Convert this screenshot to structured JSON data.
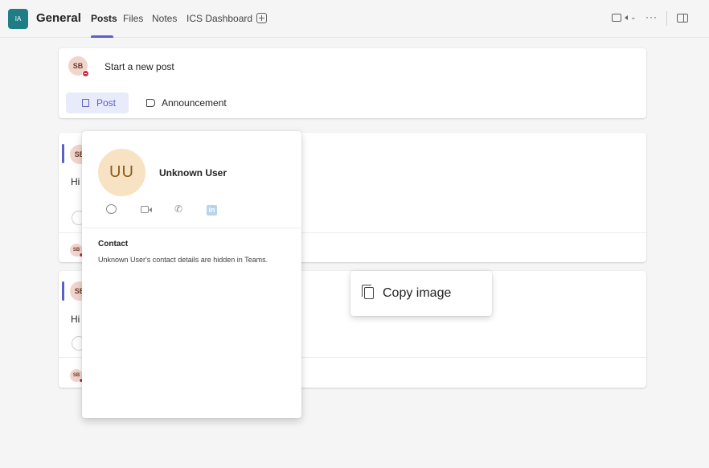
{
  "header": {
    "team_initials": "IA",
    "channel": "General",
    "tabs": [
      {
        "label": "Posts",
        "active": true
      },
      {
        "label": "Files",
        "active": false
      },
      {
        "label": "Notes",
        "active": false
      },
      {
        "label": "ICS Dashboard",
        "active": false
      }
    ],
    "more": "···",
    "chevron": "⌄"
  },
  "compose": {
    "user_initials": "SB",
    "prompt": "Start a new post",
    "post_label": "Post",
    "announcement_label": "Announcement"
  },
  "posts": [
    {
      "initials": "SB",
      "snippet": "Hi",
      "reply_initials": "SB"
    },
    {
      "initials": "SB",
      "snippet": "Hi",
      "reply_initials": "SB"
    }
  ],
  "profile_card": {
    "initials": "UU",
    "name": "Unknown User",
    "linkedin_glyph": "in",
    "contact_heading": "Contact",
    "contact_text": "Unknown User's contact details are hidden in Teams."
  },
  "context_menu": {
    "items": [
      {
        "label": "Copy image",
        "icon": "copy-icon"
      }
    ]
  },
  "colors": {
    "accent": "#5b5fc7",
    "team_avatar": "#1f7d86",
    "presence_busy": "#c4314b"
  }
}
